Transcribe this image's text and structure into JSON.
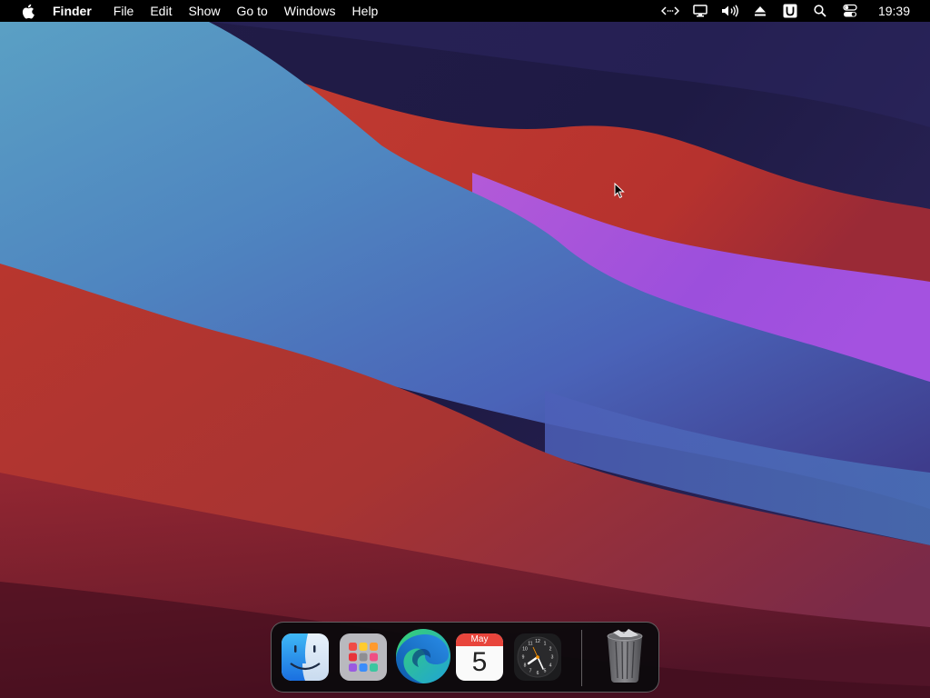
{
  "menubar": {
    "apple_icon": "apple-logo-icon",
    "app_name": "Finder",
    "menus": [
      "File",
      "Edit",
      "Show",
      "Go to",
      "Windows",
      "Help"
    ],
    "status_icons": [
      "screen-sharing-icon",
      "display-icon",
      "volume-icon",
      "eject-icon",
      "user-u-icon",
      "search-icon",
      "control-center-icon"
    ],
    "clock": "19:39"
  },
  "dock": {
    "apps": [
      {
        "name": "Finder",
        "icon": "finder-icon"
      },
      {
        "name": "Launchpad",
        "icon": "launchpad-icon"
      },
      {
        "name": "Microsoft Edge",
        "icon": "edge-icon"
      },
      {
        "name": "Calendar",
        "icon": "calendar-icon",
        "month": "May",
        "day": "5"
      },
      {
        "name": "Clock",
        "icon": "clock-icon"
      }
    ],
    "trash": {
      "name": "Trash",
      "icon": "trash-icon"
    }
  },
  "colors": {
    "menubar_bg": "#000000",
    "wallpaper_dark": "#1c1840",
    "wallpaper_blue": "#4a86b8",
    "wallpaper_red": "#b83a2e",
    "wallpaper_purple": "#9a4fd8",
    "calendar_red": "#e8453c",
    "edge_blue": "#1a7fd6",
    "edge_green": "#3fd06a"
  }
}
